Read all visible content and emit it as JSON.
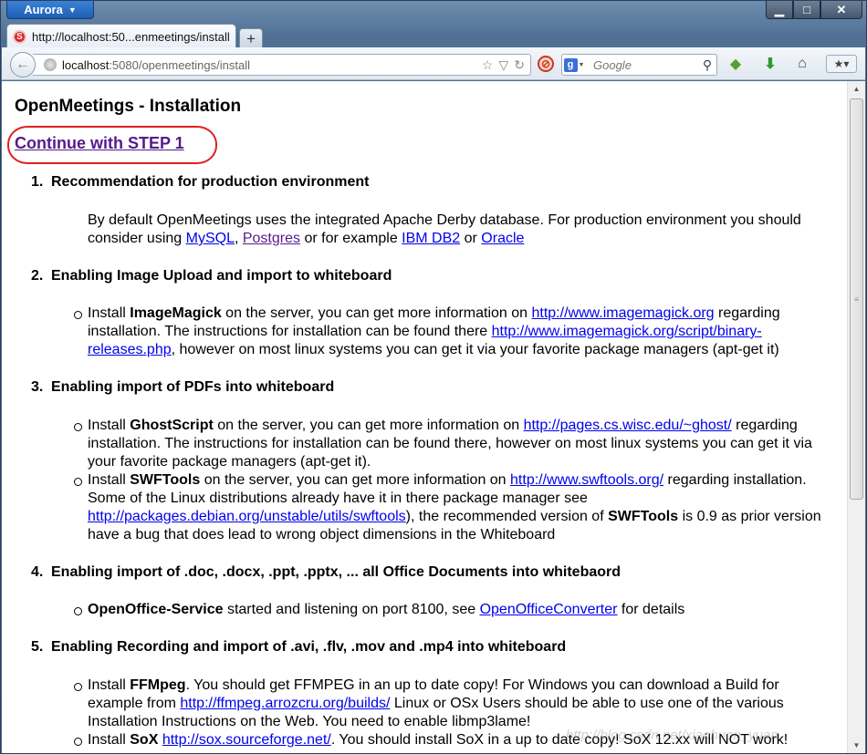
{
  "window": {
    "app_menu_label": "Aurora",
    "controls": {
      "minimize": "▁",
      "maximize": "□",
      "close": "✕"
    }
  },
  "tab": {
    "title": "http://localhost:50...enmeetings/install",
    "favicon": "S"
  },
  "newtab_label": "+",
  "urlbar": {
    "host": "localhost",
    "rest": ":5080/openmeetings/install"
  },
  "search": {
    "engine": "g",
    "placeholder": "Google"
  },
  "page": {
    "title": "OpenMeetings - Installation",
    "continue_link": "Continue with STEP 1",
    "sections": [
      {
        "num": "1.",
        "heading": "Recommendation for production environment",
        "para": {
          "t1": "By default OpenMeetings uses the integrated Apache Derby database. For production environment you should consider using ",
          "l1": "MySQL",
          "t2": ", ",
          "l2": "Postgres",
          "t3": " or for example ",
          "l3": "IBM DB2",
          "t4": " or ",
          "l4": "Oracle"
        }
      },
      {
        "num": "2.",
        "heading": "Enabling Image Upload and import to whiteboard",
        "bullet": {
          "t1": "Install ",
          "b1": "ImageMagick",
          "t2": " on the server, you can get more information on ",
          "l1": "http://www.imagemagick.org",
          "t3": " regarding installation. The instructions for installation can be found there ",
          "l2": "http://www.imagemagick.org/script/binary-releases.php",
          "t4": ", however on most linux systems you can get it via your favorite package managers (apt-get it)"
        }
      },
      {
        "num": "3.",
        "heading": "Enabling import of PDFs into whiteboard",
        "bullet1": {
          "t1": "Install ",
          "b1": "GhostScript",
          "t2": " on the server, you can get more information on ",
          "l1": "http://pages.cs.wisc.edu/~ghost/",
          "t3": " regarding installation. The instructions for installation can be found there, however on most linux systems you can get it via your favorite package managers (apt-get it)."
        },
        "bullet2": {
          "t1": "Install ",
          "b1": "SWFTools",
          "t2": " on the server, you can get more information on ",
          "l1": "http://www.swftools.org/",
          "t3": " regarding installation. Some of the Linux distributions already have it in there package manager see ",
          "l2": "http://packages.debian.org/unstable/utils/swftools",
          "t4": "), the recommended version of ",
          "b2": "SWFTools",
          "t5": " is 0.9 as prior version have a bug that does lead to wrong object dimensions in the Whiteboard"
        }
      },
      {
        "num": "4.",
        "heading": "Enabling import of .doc, .docx, .ppt, .pptx, ... all Office Documents into whitebaord",
        "bullet": {
          "b1": "OpenOffice-Service",
          "t1": " started and listening on port 8100, see ",
          "l1": "OpenOfficeConverter",
          "t2": " for details"
        }
      },
      {
        "num": "5.",
        "heading": "Enabling Recording and import of .avi, .flv, .mov and .mp4 into whiteboard",
        "bullet1": {
          "t1": "Install ",
          "b1": "FFMpeg",
          "t2": ". You should get FFMPEG in an up to date copy! For Windows you can download a Build for example from ",
          "l1": "http://ffmpeg.arrozcru.org/builds/",
          "t3": " Linux or OSx Users should be able to use one of the various Installation Instructions on the Web. You need to enable libmp3lame!"
        },
        "bullet2": {
          "t1": "Install ",
          "b1": "SoX",
          "t2": " ",
          "l1": "http://sox.sourceforge.net/",
          "t3": ". You should install SoX in a up to date copy! SoX 12.xx will NOT work!"
        }
      }
    ]
  },
  "watermark": "http://blog.csdn.net/xiaohuon_yuan",
  "colors": {
    "link": "#0000ee",
    "visited": "#551a8b",
    "highlight_oval": "#e02020"
  }
}
